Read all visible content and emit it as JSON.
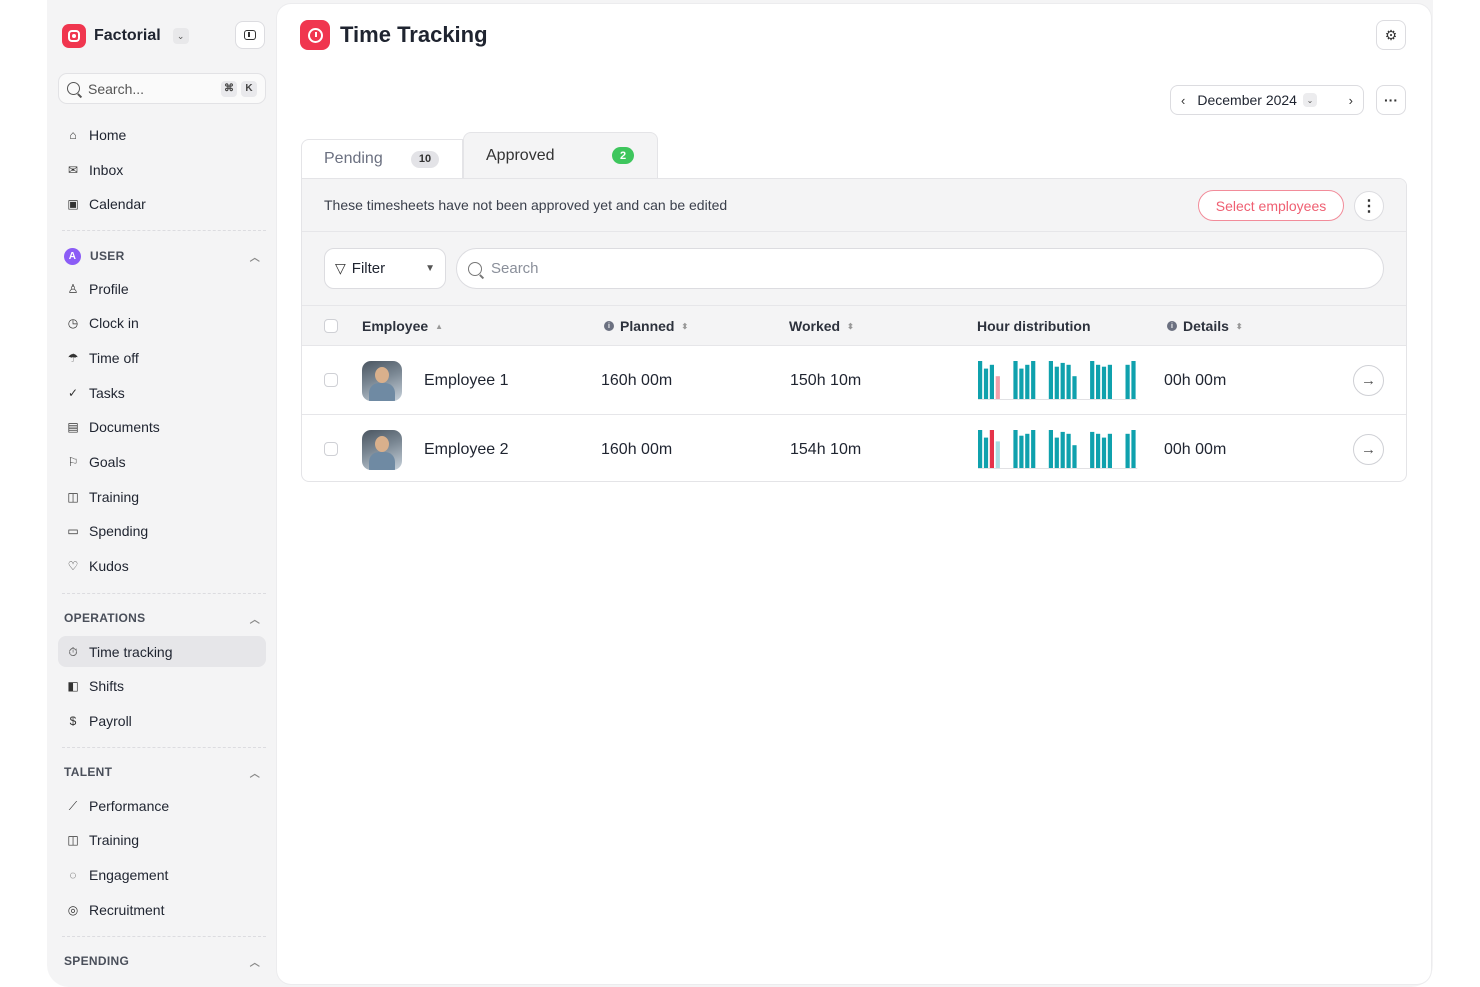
{
  "sidebar": {
    "company": "Factorial",
    "search_placeholder": "Search...",
    "shortcut_keys": [
      "⌘",
      "K"
    ],
    "top_items": [
      {
        "label": "Home",
        "icon": "home-icon",
        "glyph": "⌂"
      },
      {
        "label": "Inbox",
        "icon": "inbox-icon",
        "glyph": "✉"
      },
      {
        "label": "Calendar",
        "icon": "calendar-icon",
        "glyph": "▣"
      }
    ],
    "user_section": {
      "title": "USER",
      "avatar_letter": "A",
      "items": [
        {
          "label": "Profile",
          "icon": "person-icon",
          "glyph": "♙"
        },
        {
          "label": "Clock in",
          "icon": "clock-icon",
          "glyph": "◷"
        },
        {
          "label": "Time off",
          "icon": "umbrella-icon",
          "glyph": "☂"
        },
        {
          "label": "Tasks",
          "icon": "check-circle-icon",
          "glyph": "✓"
        },
        {
          "label": "Documents",
          "icon": "document-icon",
          "glyph": "▤"
        },
        {
          "label": "Goals",
          "icon": "flag-icon",
          "glyph": "⚐"
        },
        {
          "label": "Training",
          "icon": "book-icon",
          "glyph": "◫"
        },
        {
          "label": "Spending",
          "icon": "wallet-icon",
          "glyph": "▭"
        },
        {
          "label": "Kudos",
          "icon": "heart-icon",
          "glyph": "♡"
        }
      ]
    },
    "operations_section": {
      "title": "OPERATIONS",
      "items": [
        {
          "label": "Time tracking",
          "icon": "stopwatch-icon",
          "glyph": "⏱",
          "active": true
        },
        {
          "label": "Shifts",
          "icon": "shifts-icon",
          "glyph": "◧"
        },
        {
          "label": "Payroll",
          "icon": "payroll-icon",
          "glyph": "$"
        }
      ]
    },
    "talent_section": {
      "title": "TALENT",
      "items": [
        {
          "label": "Performance",
          "icon": "chart-line-icon",
          "glyph": "⟋"
        },
        {
          "label": "Training",
          "icon": "book-icon",
          "glyph": "◫"
        },
        {
          "label": "Engagement",
          "icon": "chat-heart-icon",
          "glyph": "◌"
        },
        {
          "label": "Recruitment",
          "icon": "search-person-icon",
          "glyph": "◎"
        }
      ]
    },
    "spending_section": {
      "title": "SPENDING"
    }
  },
  "header": {
    "title": "Time Tracking",
    "month": "December 2024"
  },
  "tabs": [
    {
      "label": "Pending",
      "count": "10"
    },
    {
      "label": "Approved",
      "count": "2"
    }
  ],
  "info_bar": {
    "message": "These timesheets have not been approved yet and can be edited",
    "select_label": "Select employees"
  },
  "filter": {
    "label": "Filter",
    "search_placeholder": "Search"
  },
  "table": {
    "columns": {
      "employee": "Employee",
      "planned": "Planned",
      "worked": "Worked",
      "distribution": "Hour distribution",
      "details": "Details"
    },
    "rows": [
      {
        "name": "Employee 1",
        "planned": "160h 00m",
        "worked": "150h 10m",
        "details": "00h 00m",
        "distribution": [
          1.0,
          0.8,
          0.9,
          0.6,
          0,
          0,
          1.0,
          0.8,
          0.9,
          1.0,
          0,
          0,
          1.0,
          0.85,
          0.95,
          0.9,
          0.6,
          0,
          0,
          1.0,
          0.9,
          0.85,
          0.9,
          0,
          0,
          0.9,
          1.0
        ],
        "bar_colors": [
          "#0fa1ad",
          "#0fa1ad",
          "#0fa1ad",
          "#f3a0ab",
          "",
          "",
          "#0fa1ad",
          "#0fa1ad",
          "#0fa1ad",
          "#0fa1ad",
          "",
          "",
          "#0fa1ad",
          "#0fa1ad",
          "#0fa1ad",
          "#0fa1ad",
          "#0fa1ad",
          "",
          "",
          "#0fa1ad",
          "#0fa1ad",
          "#0fa1ad",
          "#0fa1ad",
          "",
          "",
          "#0fa1ad",
          "#0fa1ad"
        ]
      },
      {
        "name": "Employee 2",
        "planned": "160h 00m",
        "worked": "154h 10m",
        "details": "00h 00m",
        "distribution": [
          1.0,
          0.8,
          1.0,
          0.7,
          0,
          0,
          1.0,
          0.85,
          0.9,
          1.0,
          0,
          0,
          1.0,
          0.8,
          0.95,
          0.9,
          0.6,
          0,
          0,
          0.95,
          0.9,
          0.8,
          0.9,
          0,
          0,
          0.9,
          1.0
        ],
        "bar_colors": [
          "#0fa1ad",
          "#0fa1ad",
          "#e5334a",
          "#a8dde2",
          "",
          "",
          "#0fa1ad",
          "#0fa1ad",
          "#0fa1ad",
          "#0fa1ad",
          "",
          "",
          "#0fa1ad",
          "#0fa1ad",
          "#0fa1ad",
          "#0fa1ad",
          "#0fa1ad",
          "",
          "",
          "#0fa1ad",
          "#0fa1ad",
          "#0fa1ad",
          "#0fa1ad",
          "",
          "",
          "#0fa1ad",
          "#0fa1ad"
        ]
      }
    ]
  }
}
